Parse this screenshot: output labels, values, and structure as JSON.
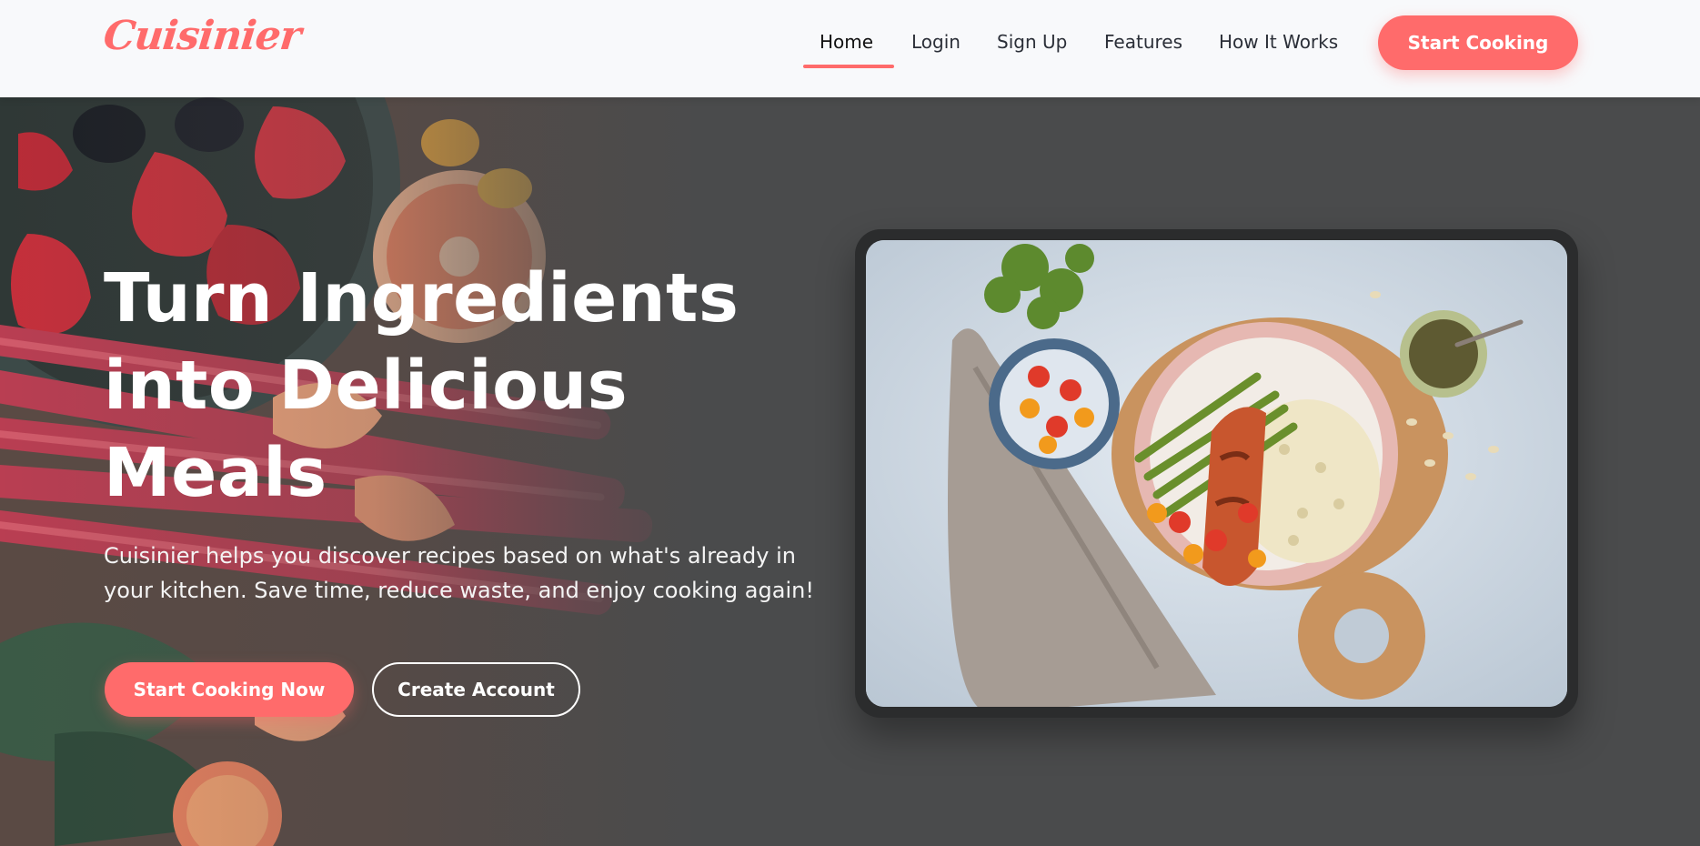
{
  "header": {
    "logo_text": "Cuisinier",
    "nav": [
      {
        "label": "Home",
        "active": true
      },
      {
        "label": "Login"
      },
      {
        "label": "Sign Up"
      },
      {
        "label": "Features"
      },
      {
        "label": "How It Works"
      }
    ],
    "cta_label": "Start Cooking"
  },
  "hero": {
    "title": "Turn Ingredients into Delicious Meals",
    "subtitle": "Cuisinier helps you discover recipes based on what's already in your kitchen. Save time, reduce waste, and enjoy cooking again!",
    "primary_button": "Start Cooking Now",
    "secondary_button": "Create Account",
    "background_image": "fruits-vegetables-flatlay",
    "feature_image": "salmon-plate-flatlay"
  },
  "colors": {
    "accent": "#ff6b6b",
    "header_bg": "#f8f9fb",
    "hero_bg": "#4a4b4c",
    "frame": "#2b2c2d"
  }
}
